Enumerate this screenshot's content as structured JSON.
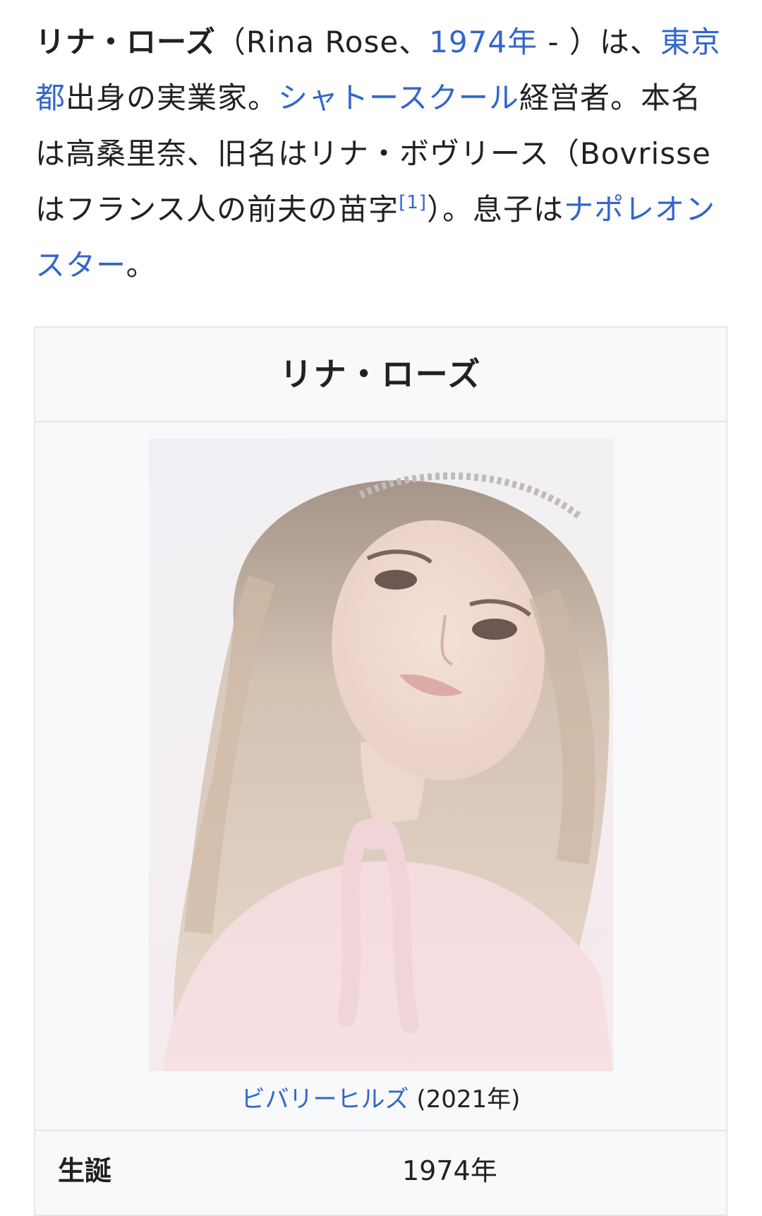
{
  "lead": {
    "name": "リナ・ローズ",
    "t1": "（Rina Rose、",
    "birth_year_link": "1974年",
    "t2": " - ）は、",
    "birthplace_link": "東京都",
    "t3": "出身の実業家。",
    "company_link": "シャトースクール",
    "t4": "経営者。本名は高桑里奈、旧名はリナ・ボヴリース（Bovrisseはフランス人の前夫の苗字",
    "ref": "[1]",
    "t5": "）。息子は",
    "son_link": "ナポレオン スター",
    "t6": "。"
  },
  "infobox": {
    "title": "リナ・ローズ",
    "caption_link": "ビバリーヒルズ",
    "caption_year": " (2021年)",
    "born_label": "生誕",
    "born_value": "1974年"
  },
  "colors": {
    "link": "#3366cc",
    "text": "#202122",
    "infobox_bg": "#f8f9fa",
    "infobox_border": "#e4e6ea"
  }
}
